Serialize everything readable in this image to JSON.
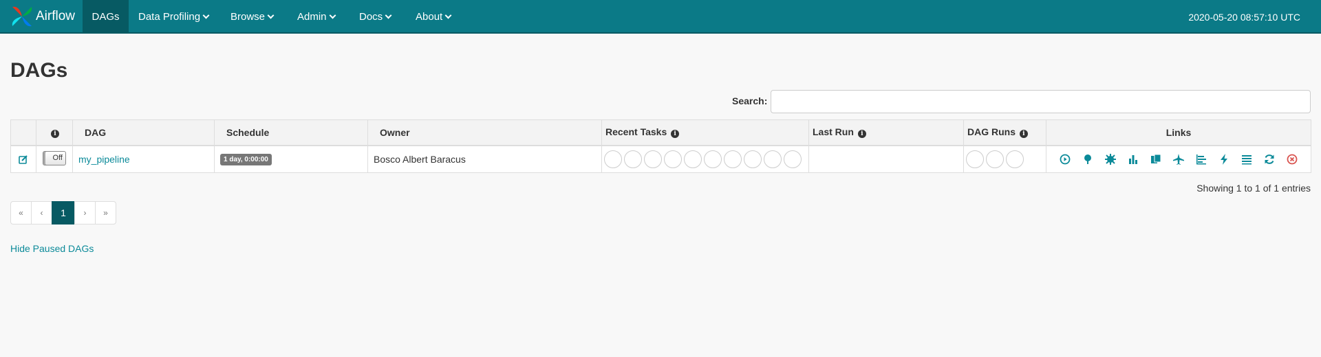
{
  "navbar": {
    "brand": "Airflow",
    "items": [
      {
        "label": "DAGs",
        "active": true,
        "dropdown": false
      },
      {
        "label": "Data Profiling",
        "dropdown": true
      },
      {
        "label": "Browse",
        "dropdown": true
      },
      {
        "label": "Admin",
        "dropdown": true
      },
      {
        "label": "Docs",
        "dropdown": true
      },
      {
        "label": "About",
        "dropdown": true
      }
    ],
    "clock": "2020-05-20 08:57:10 UTC"
  },
  "page_title": "DAGs",
  "search": {
    "label": "Search:",
    "value": ""
  },
  "table": {
    "headers": {
      "info": "i",
      "dag": "DAG",
      "schedule": "Schedule",
      "owner": "Owner",
      "recent_tasks": "Recent Tasks",
      "last_run": "Last Run",
      "dag_runs": "DAG Runs",
      "links": "Links"
    },
    "rows": [
      {
        "toggle": "Off",
        "dag_id": "my_pipeline",
        "schedule": "1 day, 0:00:00",
        "owner": "Bosco Albert Baracus",
        "recent_tasks_count": 10,
        "last_run": "",
        "dag_runs_count": 3
      }
    ],
    "link_icons": [
      "trigger-dag-icon",
      "tree-view-icon",
      "graph-view-icon",
      "task-duration-icon",
      "task-tries-icon",
      "landing-times-icon",
      "gantt-icon",
      "code-view-icon",
      "logs-icon",
      "refresh-icon",
      "delete-icon"
    ]
  },
  "showing": "Showing 1 to 1 of 1 entries",
  "pagination": {
    "first": "«",
    "prev": "‹",
    "current": "1",
    "next": "›",
    "last": "»"
  },
  "hide_paused": "Hide Paused DAGs",
  "colors": {
    "navbar": "#0b7a87",
    "navbar_active": "#075a63",
    "link": "#0b8a99",
    "danger": "#d9534f"
  }
}
